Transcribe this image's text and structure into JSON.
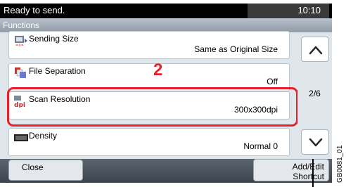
{
  "status": {
    "message": "Ready to send.",
    "time": "10:10"
  },
  "screen": {
    "title": "Functions"
  },
  "rows": [
    {
      "name": "Sending Size",
      "value": "Same as Original Size",
      "icon": "sending-size-icon"
    },
    {
      "name": "File Separation",
      "value": "Off",
      "icon": "file-separation-icon"
    },
    {
      "name": "Scan Resolution",
      "value": "300x300dpi",
      "icon": "dpi-icon"
    },
    {
      "name": "Density",
      "value": "Normal 0",
      "icon": "density-icon"
    }
  ],
  "annotation": {
    "callout": "2",
    "figure_id": "GB0081_01"
  },
  "pagination": {
    "label": "2/6"
  },
  "footer": {
    "close_label": "Close",
    "add_edit_line1": "Add/Edit",
    "add_edit_line2": "Shortcut"
  },
  "colors": {
    "highlight": "#e8202a",
    "status_bar": "#000000",
    "panel": "#dfe6ec"
  }
}
